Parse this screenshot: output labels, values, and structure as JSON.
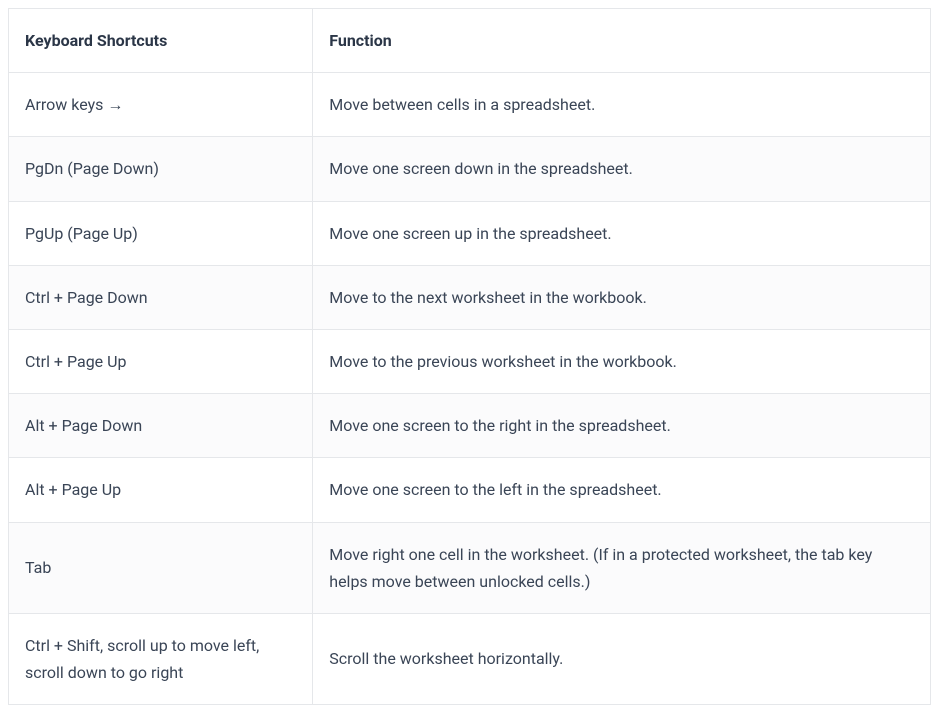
{
  "table": {
    "headers": {
      "shortcut": "Keyboard Shortcuts",
      "function": "Function"
    },
    "rows": [
      {
        "shortcut": "Arrow keys →",
        "function": "Move between cells in a spreadsheet."
      },
      {
        "shortcut": "PgDn (Page Down)",
        "function": "Move one screen down in the spreadsheet."
      },
      {
        "shortcut": "PgUp (Page Up)",
        "function": "Move one screen up in the spreadsheet."
      },
      {
        "shortcut": "Ctrl + Page Down",
        "function": "Move to the next worksheet in the workbook."
      },
      {
        "shortcut": "Ctrl + Page Up",
        "function": "Move to the previous worksheet in the workbook."
      },
      {
        "shortcut": "Alt + Page Down",
        "function": "Move one screen to the right in the spreadsheet."
      },
      {
        "shortcut": "Alt + Page Up",
        "function": "Move one screen to the left in the spreadsheet."
      },
      {
        "shortcut": "Tab",
        "function": "Move right one cell in the worksheet. (If in a protected worksheet, the tab key helps move between unlocked cells.)"
      },
      {
        "shortcut": "Ctrl + Shift, scroll up to move left, scroll down to go right",
        "function": "Scroll the worksheet horizontally."
      }
    ]
  }
}
